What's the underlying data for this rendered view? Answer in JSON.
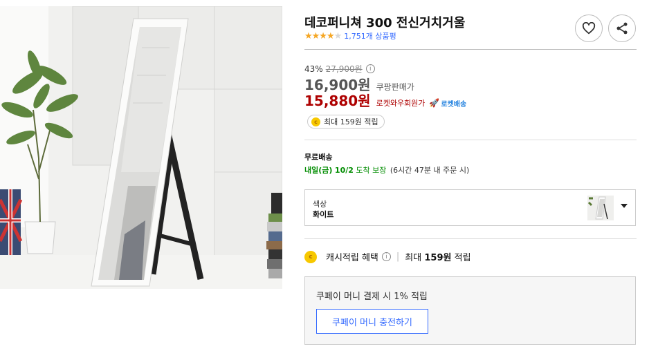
{
  "product": {
    "title": "데코퍼니쳐 300 전신거치거울",
    "rating_stars": "★★★★",
    "rating_half_star": "★",
    "rating_value": 4.5,
    "review_count": "1,751개 상품평"
  },
  "actions": {
    "wishlist_icon": "heart-icon",
    "share_icon": "share-icon"
  },
  "price": {
    "discount_rate": "43%",
    "original_price": "27,900원",
    "sale_price": "16,900원",
    "sale_label": "쿠팡판매가",
    "member_price": "15,880원",
    "member_label": "로켓와우회원가",
    "rocket_label": "로켓배송"
  },
  "reward": {
    "coin_symbol": "c",
    "pill_text": "최대 159원 적립"
  },
  "shipping": {
    "title": "무료배송",
    "arrival_prefix": "내일(금)",
    "arrival_date": "10/2",
    "arrival_suffix": "도착 보장",
    "note": "(6시간 47분 내 주문 시)"
  },
  "option": {
    "label": "색상",
    "value": "화이트"
  },
  "cash": {
    "label": "캐시적립 혜택",
    "max_prefix": "최대",
    "max_amount": "159원",
    "max_suffix": "적립"
  },
  "pay": {
    "text": "쿠페이 머니 결제 시 1% 적립",
    "button_label": "쿠페이 머니 충전하기"
  },
  "colors": {
    "rating_star": "#f5a623",
    "link_blue": "#346aff",
    "member_red": "#ae0000",
    "delivery_green": "#008c00",
    "coin_yellow": "#f7c800"
  }
}
